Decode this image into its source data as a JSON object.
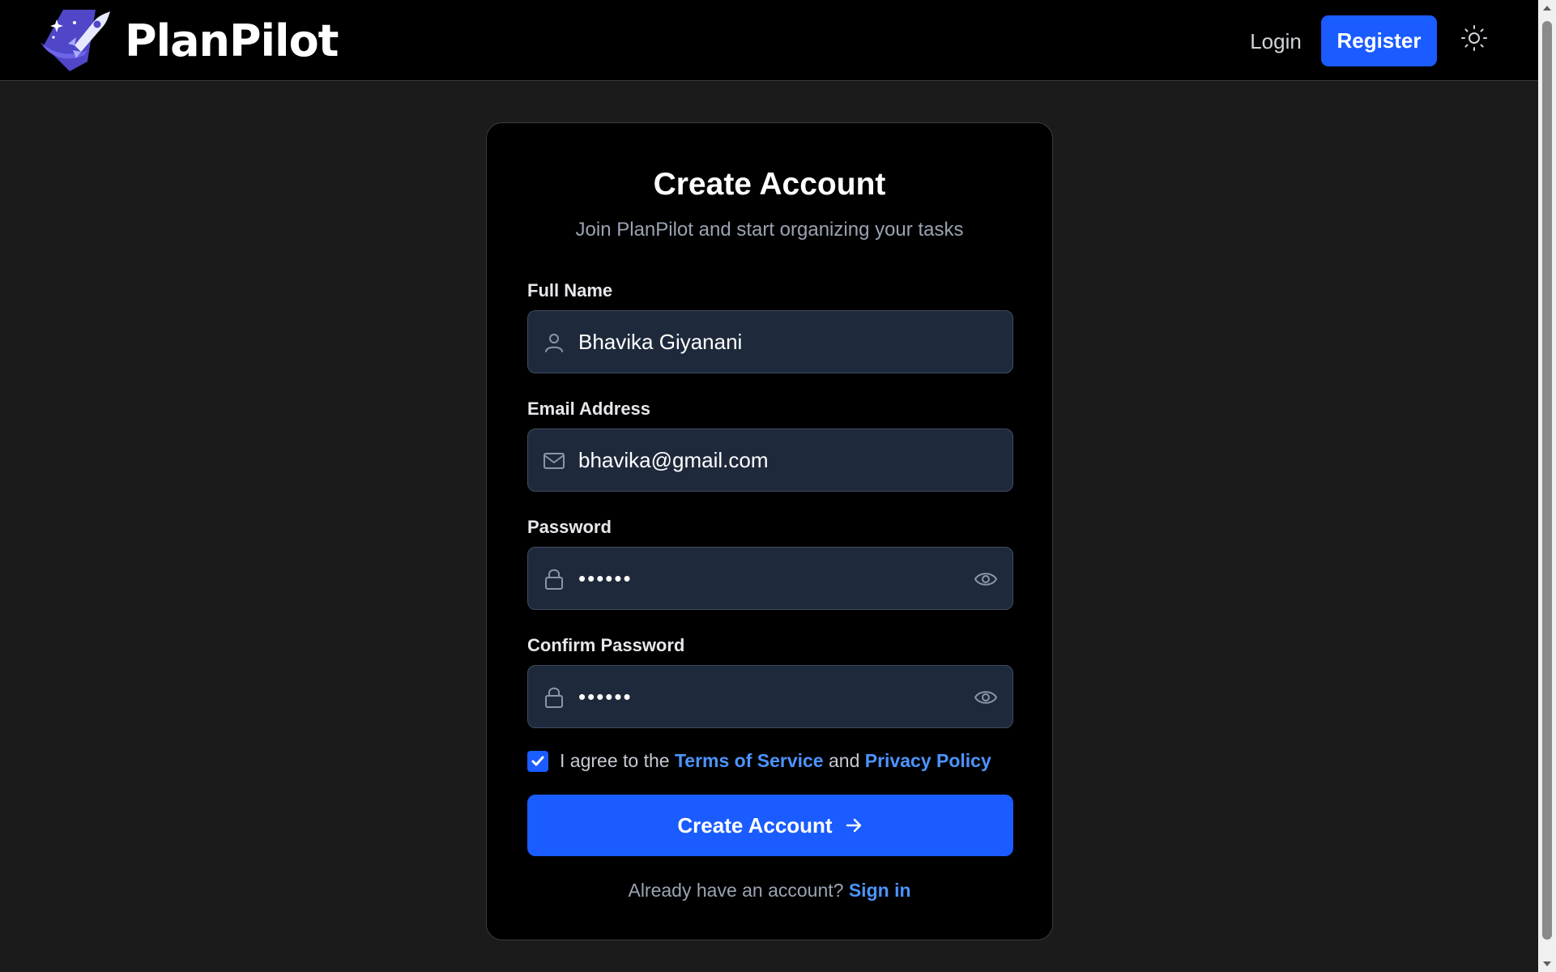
{
  "header": {
    "brand_name": "PlanPilot",
    "login_label": "Login",
    "register_label": "Register"
  },
  "card": {
    "title": "Create Account",
    "subtitle": "Join PlanPilot and start organizing your tasks"
  },
  "form": {
    "full_name": {
      "label": "Full Name",
      "value": "Bhavika Giyanani"
    },
    "email": {
      "label": "Email Address",
      "value": "bhavika@gmail.com"
    },
    "password": {
      "label": "Password",
      "value": "••••••"
    },
    "confirm_password": {
      "label": "Confirm Password",
      "value": "••••••"
    },
    "agree": {
      "checked": true,
      "prefix": "I agree to the ",
      "terms_link": "Terms of Service",
      "middle": " and ",
      "privacy_link": "Privacy Policy"
    },
    "submit_label": "Create Account",
    "signin_prompt": "Already have an account? ",
    "signin_link": "Sign in"
  },
  "colors": {
    "accent": "#1a5cff",
    "link": "#4c94ff",
    "page_bg": "#1b1b1b",
    "card_bg": "#000000",
    "input_bg": "#1e293b"
  },
  "icons": {
    "brand": "rocket-logo-icon",
    "theme_toggle": "sun-icon",
    "full_name": "user-icon",
    "email": "mail-icon",
    "password": "lock-icon",
    "reveal": "eye-icon",
    "submit": "arrow-right-icon"
  }
}
